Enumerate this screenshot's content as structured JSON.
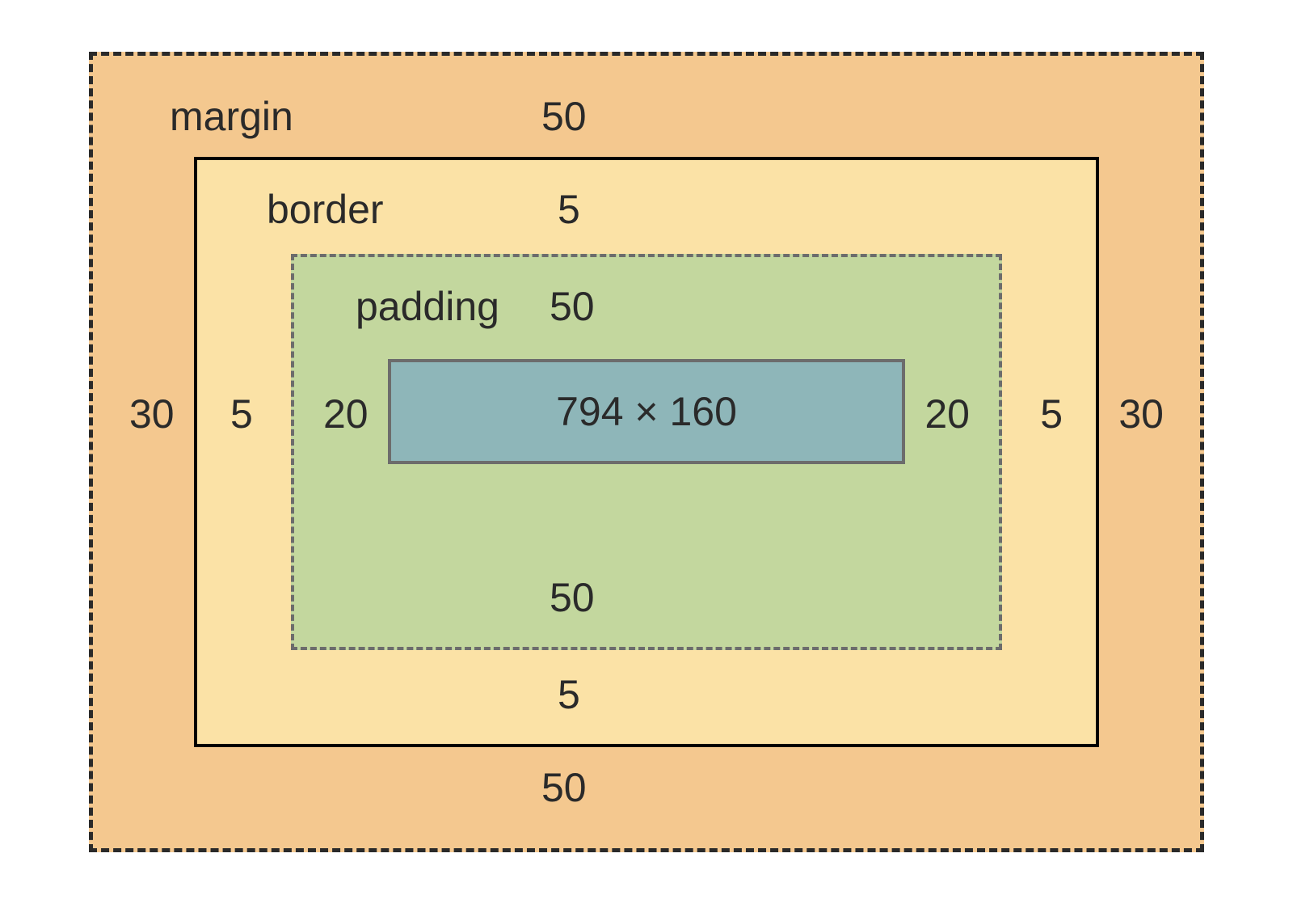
{
  "boxmodel": {
    "margin": {
      "label": "margin",
      "top": "50",
      "right": "30",
      "bottom": "50",
      "left": "30"
    },
    "border": {
      "label": "border",
      "top": "5",
      "right": "5",
      "bottom": "5",
      "left": "5"
    },
    "padding": {
      "label": "padding",
      "top": "50",
      "right": "20",
      "bottom": "50",
      "left": "20"
    },
    "content": {
      "size": "794 × 160"
    }
  },
  "colors": {
    "margin": "#f4c88f",
    "border": "#fbe2a6",
    "padding": "#c3d79e",
    "content": "#8eb6b9"
  }
}
